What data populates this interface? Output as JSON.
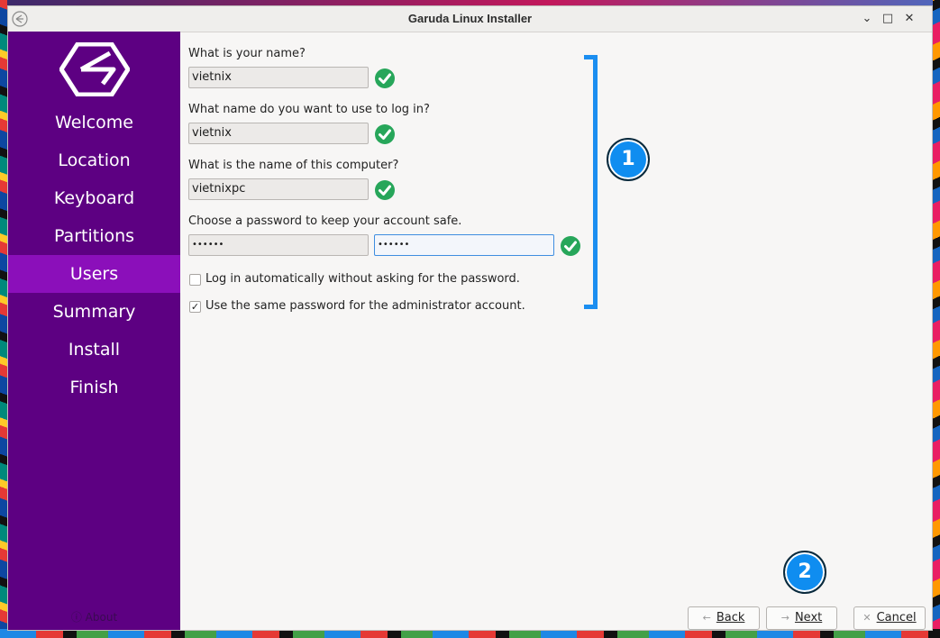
{
  "window": {
    "title": "Garuda Linux Installer",
    "minimize_glyph": "⌄",
    "maximize_glyph": "□",
    "close_glyph": "✕"
  },
  "sidebar": {
    "steps": [
      {
        "label": "Welcome"
      },
      {
        "label": "Location"
      },
      {
        "label": "Keyboard"
      },
      {
        "label": "Partitions"
      },
      {
        "label": "Users"
      },
      {
        "label": "Summary"
      },
      {
        "label": "Install"
      },
      {
        "label": "Finish"
      }
    ],
    "active_step": "Users",
    "about_label": "About",
    "about_icon": "info-icon"
  },
  "form": {
    "name_label": "What is your name?",
    "name_value": "vietnix",
    "login_label": "What name do you want to use to log in?",
    "login_value": "vietnix",
    "computer_label": "What is the name of this computer?",
    "computer_value": "vietnixpc",
    "password_label": "Choose a password to keep your account safe.",
    "password_value": "••••••",
    "password_confirm_value": "••••••",
    "autologin_label": "Log in automatically without asking for the password.",
    "autologin_checked": false,
    "same_admin_label": "Use the same password for the administrator account.",
    "same_admin_checked": true,
    "valid_icon": "check-circle-icon"
  },
  "annotations": {
    "badge_1": "1",
    "badge_2": "2"
  },
  "buttons": {
    "back": {
      "label": "Back",
      "icon": "arrow-left-icon"
    },
    "next": {
      "label": "Next",
      "icon": "arrow-right-icon"
    },
    "cancel": {
      "label": "Cancel",
      "icon": "x-icon"
    }
  },
  "colors": {
    "sidebar_bg": "#5d0082",
    "sidebar_active": "#8b0fba",
    "check_green": "#27a65a",
    "annotation_blue": "#1b8ef0",
    "focus_blue": "#3f8ee0"
  }
}
